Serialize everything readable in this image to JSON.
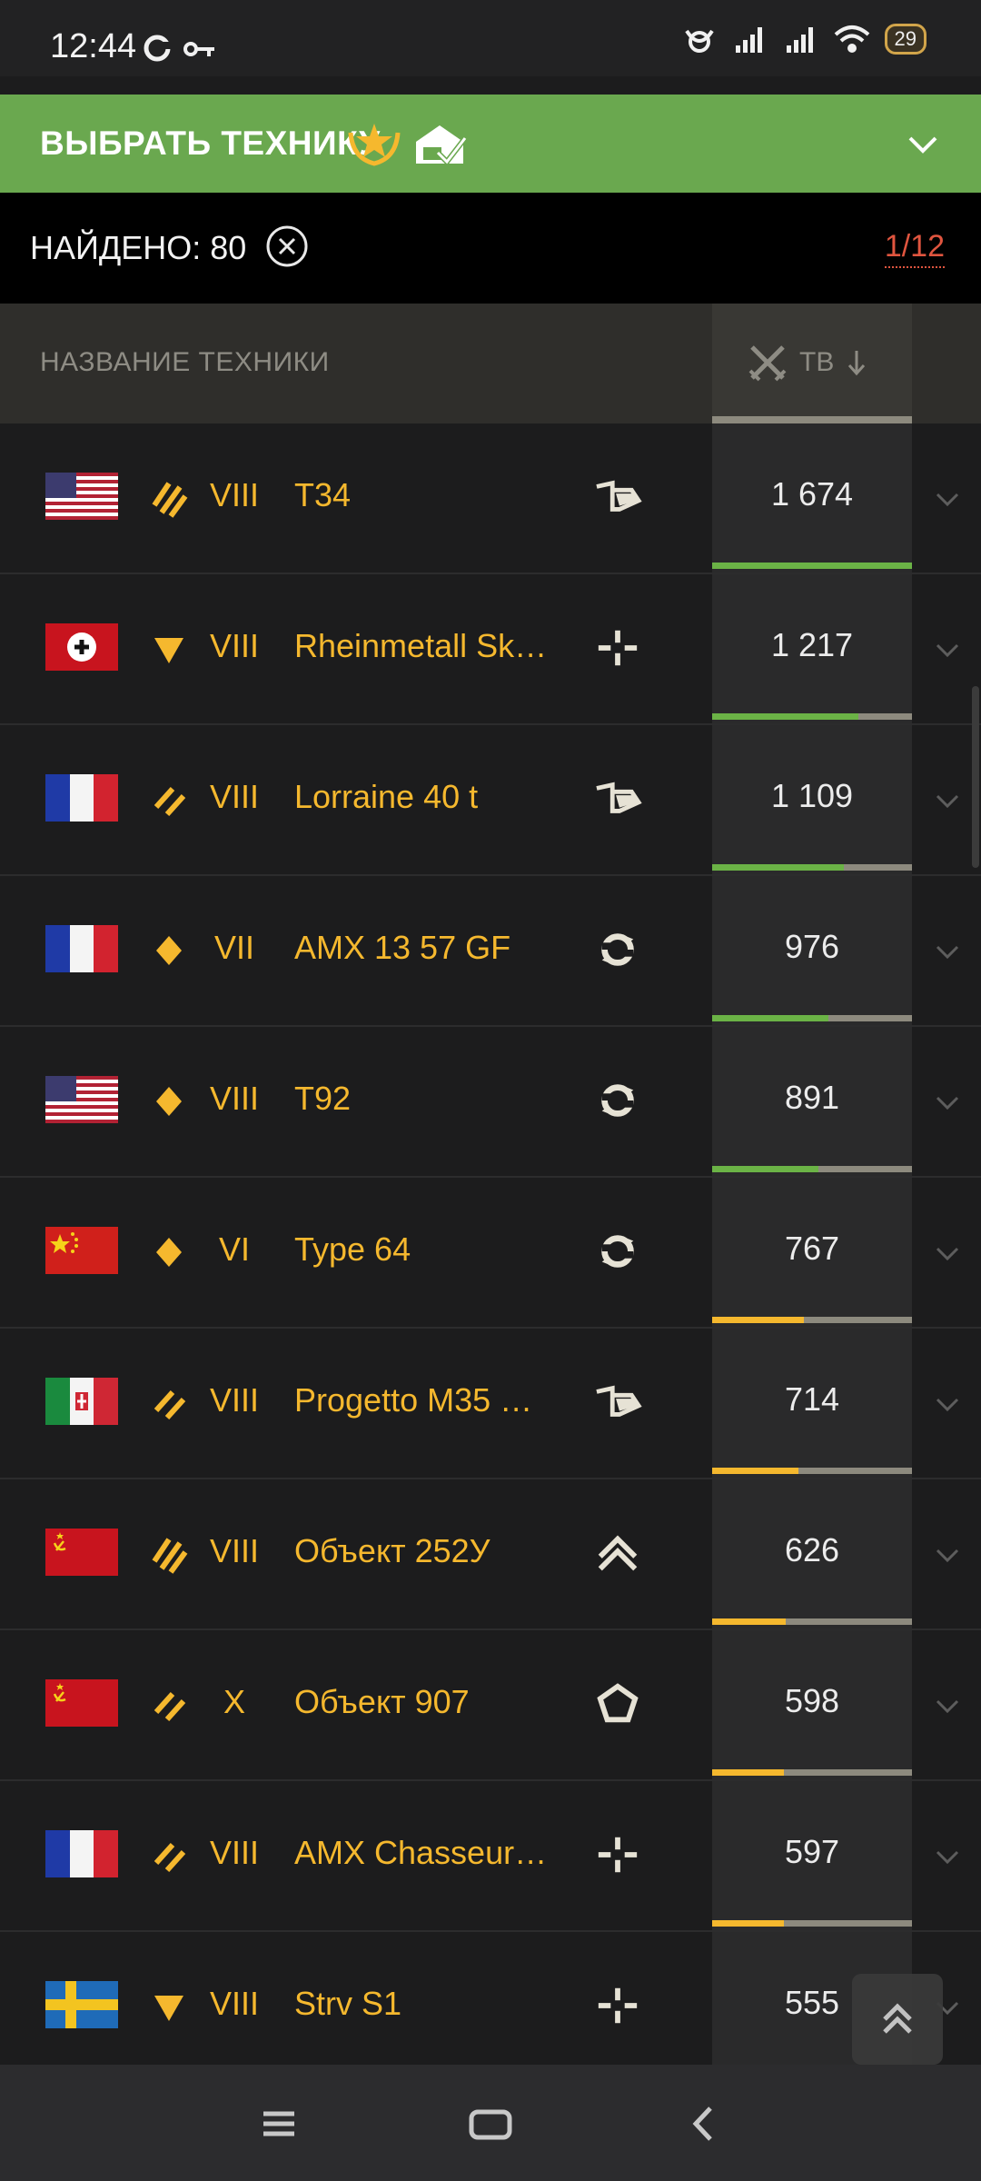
{
  "status_bar": {
    "time": "12:44",
    "battery": "29",
    "icons": [
      "sync-icon",
      "key-icon",
      "alarm-icon",
      "signal-icon",
      "signal-icon",
      "wifi-icon"
    ]
  },
  "header": {
    "title": "ВЫБРАТЬ ТЕХНИКУ",
    "badges": [
      "laurel-star-icon",
      "garage-check-icon"
    ]
  },
  "found": {
    "label": "НАЙДЕНО: 80",
    "page": "1/12"
  },
  "table": {
    "col_name": "НАЗВАНИЕ ТЕХНИКИ",
    "col_tv": "ТВ",
    "sort": "descending",
    "rows": [
      {
        "nation": "usa",
        "role": "heavy-striped-3",
        "tier": "VIII",
        "name": "T34",
        "cls": "flamethrower",
        "tv": "1 674",
        "fill": 1.0,
        "bar_color": "#6bb346"
      },
      {
        "nation": "germany",
        "role": "triangle",
        "tier": "VIII",
        "name": "Rheinmetall Sk…",
        "cls": "crosshair",
        "tv": "1 217",
        "fill": 0.73,
        "bar_color": "#6bb346"
      },
      {
        "nation": "france",
        "role": "stripes-2",
        "tier": "VIII",
        "name": "Lorraine 40 t",
        "cls": "flamethrower",
        "tv": "1 109",
        "fill": 0.66,
        "bar_color": "#6bb346"
      },
      {
        "nation": "france",
        "role": "diamond",
        "tier": "VII",
        "name": "AMX 13 57 GF",
        "cls": "circle-arrows",
        "tv": "976",
        "fill": 0.58,
        "bar_color": "#6bb346"
      },
      {
        "nation": "usa",
        "role": "diamond",
        "tier": "VIII",
        "name": "T92",
        "cls": "circle-arrows",
        "tv": "891",
        "fill": 0.53,
        "bar_color": "#6bb346"
      },
      {
        "nation": "china",
        "role": "diamond",
        "tier": "VI",
        "name": "Type 64",
        "cls": "circle-arrows",
        "tv": "767",
        "fill": 0.46,
        "bar_color": "#f5b82e"
      },
      {
        "nation": "italy",
        "role": "stripes-2",
        "tier": "VIII",
        "name": "Progetto M35 …",
        "cls": "flamethrower",
        "tv": "714",
        "fill": 0.43,
        "bar_color": "#f5b82e"
      },
      {
        "nation": "ussr",
        "role": "heavy-striped-3",
        "tier": "VIII",
        "name": "Объект 252У",
        "cls": "double-chevron",
        "tv": "626",
        "fill": 0.37,
        "bar_color": "#f5b82e"
      },
      {
        "nation": "ussr",
        "role": "stripes-2",
        "tier": "X",
        "name": "Объект 907",
        "cls": "pentagon",
        "tv": "598",
        "fill": 0.36,
        "bar_color": "#f5b82e"
      },
      {
        "nation": "france",
        "role": "stripes-2",
        "tier": "VIII",
        "name": "AMX Chasseur…",
        "cls": "crosshair",
        "tv": "597",
        "fill": 0.36,
        "bar_color": "#f5b82e"
      },
      {
        "nation": "sweden",
        "role": "triangle",
        "tier": "VIII",
        "name": "Strv S1",
        "cls": "crosshair",
        "tv": "555",
        "fill": 0.33,
        "bar_color": "#f5b82e"
      }
    ]
  },
  "colors": {
    "accent_green": "#6aa84f",
    "tier_gold": "#f5b82e",
    "page_red": "#e0553f"
  }
}
